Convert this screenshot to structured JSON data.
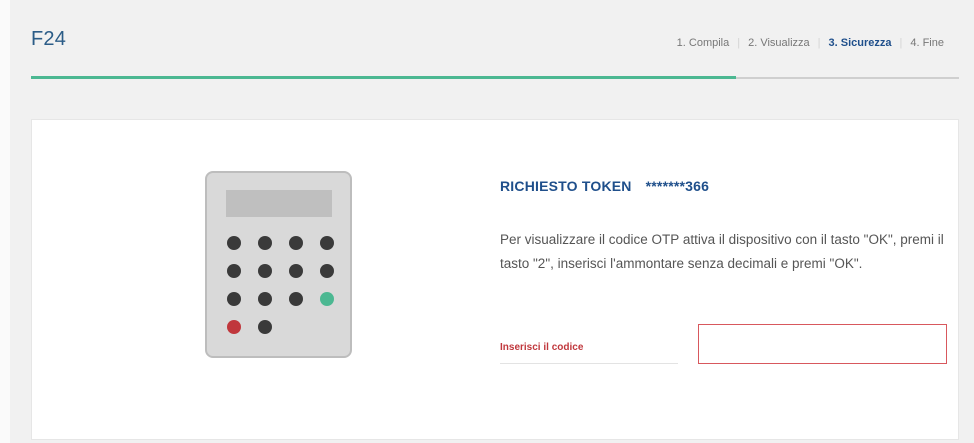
{
  "header": {
    "title": "F24",
    "steps": [
      {
        "label": "1. Compila",
        "active": false
      },
      {
        "label": "2. Visualizza",
        "active": false
      },
      {
        "label": "3. Sicurezza",
        "active": true
      },
      {
        "label": "4. Fine",
        "active": false
      }
    ],
    "progress_fraction": 0.76
  },
  "token": {
    "title": "RICHIESTO TOKEN",
    "masked_number": "*******366",
    "instructions": "Per visualizzare il codice OTP attiva il dispositivo con il tasto \"OK\", premi il tasto \"2\", inserisci l'ammontare senza decimali e premi \"OK\".",
    "code_label": "Inserisci il codice",
    "code_value": ""
  },
  "colors": {
    "accent_green": "#4cb892",
    "brand_blue": "#1f4f8b",
    "error_red": "#c0373c"
  },
  "icons": {
    "device": "otp-token-device-icon"
  }
}
